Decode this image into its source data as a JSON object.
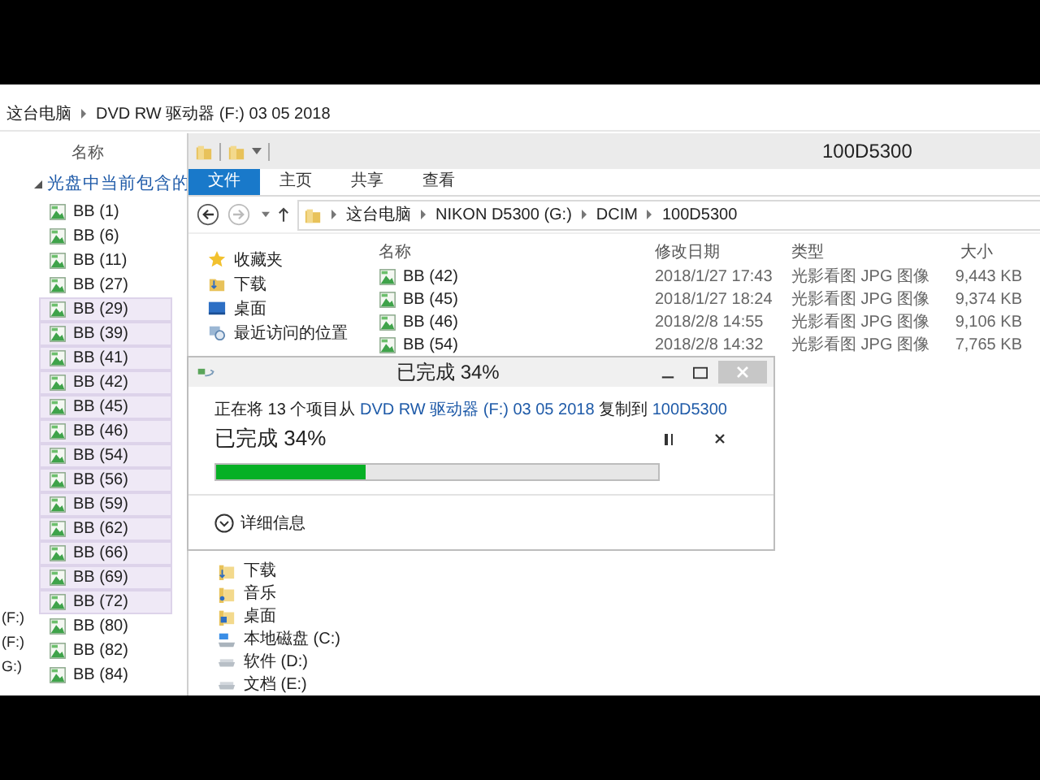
{
  "back_window": {
    "address": [
      "这台电脑",
      "DVD RW 驱动器 (F:) 03 05 2018"
    ],
    "column_header": "名称",
    "group_label": "光盘中当前包含的",
    "edge_labels": [
      "(F:)",
      "(F:)",
      "G:)"
    ],
    "items": [
      {
        "name": "BB (1)",
        "selected": false
      },
      {
        "name": "BB (6)",
        "selected": false
      },
      {
        "name": "BB (11)",
        "selected": false
      },
      {
        "name": "BB (27)",
        "selected": false
      },
      {
        "name": "BB (29)",
        "selected": true
      },
      {
        "name": "BB (39)",
        "selected": true
      },
      {
        "name": "BB (41)",
        "selected": true
      },
      {
        "name": "BB (42)",
        "selected": true
      },
      {
        "name": "BB (45)",
        "selected": true
      },
      {
        "name": "BB (46)",
        "selected": true
      },
      {
        "name": "BB (54)",
        "selected": true
      },
      {
        "name": "BB (56)",
        "selected": true
      },
      {
        "name": "BB (59)",
        "selected": true
      },
      {
        "name": "BB (62)",
        "selected": true
      },
      {
        "name": "BB (66)",
        "selected": true
      },
      {
        "name": "BB (69)",
        "selected": true
      },
      {
        "name": "BB (72)",
        "selected": true
      },
      {
        "name": "BB (80)",
        "selected": false
      },
      {
        "name": "BB (82)",
        "selected": false
      },
      {
        "name": "BB (84)",
        "selected": false
      }
    ]
  },
  "explorer": {
    "title": "100D5300",
    "ribbon_tabs": [
      {
        "label": "文件",
        "selected": true
      },
      {
        "label": "主页",
        "selected": false
      },
      {
        "label": "共享",
        "selected": false
      },
      {
        "label": "查看",
        "selected": false
      }
    ],
    "address": [
      "这台电脑",
      "NIKON D5300 (G:)",
      "DCIM",
      "100D5300"
    ],
    "nav_top": [
      {
        "label": "收藏夹",
        "kind": "star"
      },
      {
        "label": "下载",
        "kind": "download"
      },
      {
        "label": "桌面",
        "kind": "desktop"
      },
      {
        "label": "最近访问的位置",
        "kind": "recent"
      }
    ],
    "nav_bottom": [
      {
        "label": "下载",
        "kind": "download"
      },
      {
        "label": "音乐",
        "kind": "music"
      },
      {
        "label": "桌面",
        "kind": "desktop"
      },
      {
        "label": "本地磁盘 (C:)",
        "kind": "system-drive"
      },
      {
        "label": "软件 (D:)",
        "kind": "drive"
      },
      {
        "label": "文档 (E:)",
        "kind": "drive"
      }
    ],
    "columns": [
      "名称",
      "修改日期",
      "类型",
      "大小"
    ],
    "files": [
      {
        "name": "BB (42)",
        "date": "2018/1/27 17:43",
        "type": "光影看图 JPG 图像",
        "size": "9,443 KB"
      },
      {
        "name": "BB (45)",
        "date": "2018/1/27 18:24",
        "type": "光影看图 JPG 图像",
        "size": "9,374 KB"
      },
      {
        "name": "BB (46)",
        "date": "2018/2/8 14:55",
        "type": "光影看图 JPG 图像",
        "size": "9,106 KB"
      },
      {
        "name": "BB (54)",
        "date": "2018/2/8 14:32",
        "type": "光影看图 JPG 图像",
        "size": "7,765 KB"
      }
    ]
  },
  "copy_dialog": {
    "title": "已完成 34%",
    "message": [
      {
        "text": "正在将 13 个项目从 ",
        "link": false
      },
      {
        "text": "DVD RW 驱动器 (F:) 03 05 2018",
        "link": true
      },
      {
        "text": " 复制到 ",
        "link": false
      },
      {
        "text": "100D5300",
        "link": true
      }
    ],
    "heading": "已完成 34%",
    "level": 0.34,
    "details_label": "详细信息"
  }
}
